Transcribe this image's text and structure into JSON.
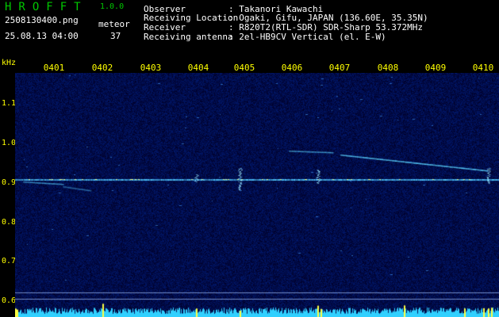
{
  "app": {
    "name": "HROFFT",
    "version": "1.0.0",
    "file_name": "2508130400.png",
    "datetime": "25.08.13 04:00",
    "meteor_label": "meteor",
    "meteor_count": "37"
  },
  "info": {
    "rows": [
      {
        "label": "Observer",
        "value": ": Takanori Kawachi"
      },
      {
        "label": "Receiving Location",
        "value": ": Ogaki, Gifu, JAPAN (136.60E, 35.35N)"
      },
      {
        "label": "Receiver",
        "value": ": R820T2(RTL-SDR) SDR-Sharp 53.372MHz"
      },
      {
        "label": "Receiving antenna",
        "value": ": 2el-HB9CV Vertical (el. E-W)"
      }
    ]
  },
  "axis": {
    "freq_unit": "kHz",
    "time_ticks": [
      "0401",
      "0402",
      "0403",
      "0404",
      "0405",
      "0406",
      "0407",
      "0408",
      "0409",
      "0410"
    ],
    "freq_ticks": [
      "1.1",
      "1.0",
      "0.9",
      "0.8",
      "0.7",
      "0.6"
    ]
  },
  "colors": {
    "background": "#000000",
    "header_green": "#00c800",
    "axis_yellow": "#ffff00",
    "signal_cyan": "#40e0ff"
  }
}
